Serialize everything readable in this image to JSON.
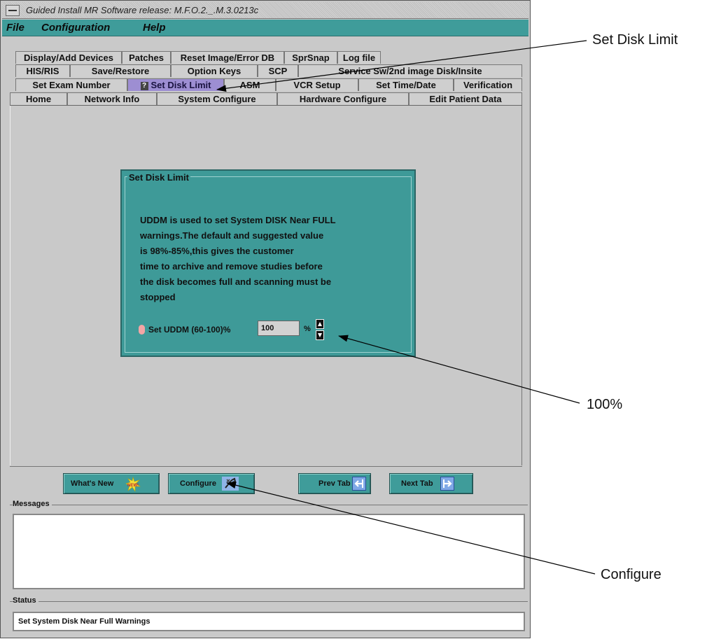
{
  "window": {
    "title": "Guided Install  MR Software release: M.F.O.2._.M.3.0213c"
  },
  "menubar": {
    "items": [
      "File",
      "Configuration",
      "Help"
    ]
  },
  "tabs": {
    "row1": [
      "Display/Add Devices",
      "Patches",
      "Reset Image/Error DB",
      "SprSnap",
      "Log file"
    ],
    "row2": [
      "HIS/RIS",
      "Save/Restore",
      "Option Keys",
      "SCP",
      "Service Sw/2nd image Disk/Insite"
    ],
    "row3": [
      "Set Exam Number",
      "Set Disk Limit",
      "ASM",
      "VCR Setup",
      "Set Time/Date",
      "Verification"
    ],
    "row4": [
      "Home",
      "Network Info",
      "System Configure",
      "Hardware Configure",
      "Edit Patient Data"
    ],
    "active": "Set Disk Limit"
  },
  "panel": {
    "legend": "Set Disk Limit",
    "description_lines": [
      "UDDM is used to set System DISK Near FULL",
      "warnings.The default and suggested value",
      "is 98%-85%,this gives the customer",
      "time to archive and remove studies before",
      "the disk becomes full and scanning must be",
      "stopped"
    ],
    "uddm_label": "Set UDDM (60-100)%",
    "uddm_value": "100",
    "uddm_unit": "%"
  },
  "buttons": {
    "whats_new": "What's New",
    "configure": "Configure",
    "prev_tab": "Prev Tab",
    "next_tab": "Next Tab",
    "new_badge": "NEW!"
  },
  "messages": {
    "label": "Messages",
    "text": ""
  },
  "status": {
    "label": "Status",
    "text": "Set System Disk Near Full Warnings"
  },
  "callouts": {
    "set_disk_limit": "Set Disk Limit",
    "hundred_percent": "100%",
    "configure": "Configure"
  },
  "colors": {
    "teal": "#3f9c9a",
    "active_tab": "#9d8ed2",
    "window_bg": "#c9c9c9"
  }
}
